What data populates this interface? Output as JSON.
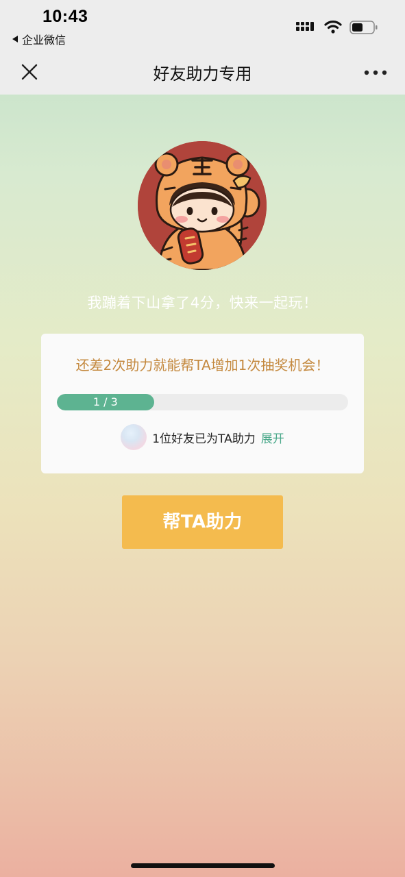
{
  "status_bar": {
    "time": "10:43",
    "back_app": "企业微信",
    "icons": [
      "signal-icon",
      "wifi-icon",
      "battery-icon"
    ]
  },
  "nav": {
    "title": "好友助力专用",
    "close_icon": "close-icon",
    "more_icon": "more-icon"
  },
  "share_text": "我蹦着下山拿了4分，快来一起玩！",
  "card": {
    "message": "还差2次助力就能帮TA增加1次抽奖机会！",
    "progress": {
      "label": "1 / 3",
      "current": 1,
      "total": 3
    },
    "helpers_text": "1位好友已为TA助力",
    "expand_label": "展开"
  },
  "help_button": "帮TA助力",
  "colors": {
    "accent_green": "#5db391",
    "button_orange": "#f4bb4e",
    "message_gold": "#c4893f",
    "link_green": "#4aa88a"
  }
}
